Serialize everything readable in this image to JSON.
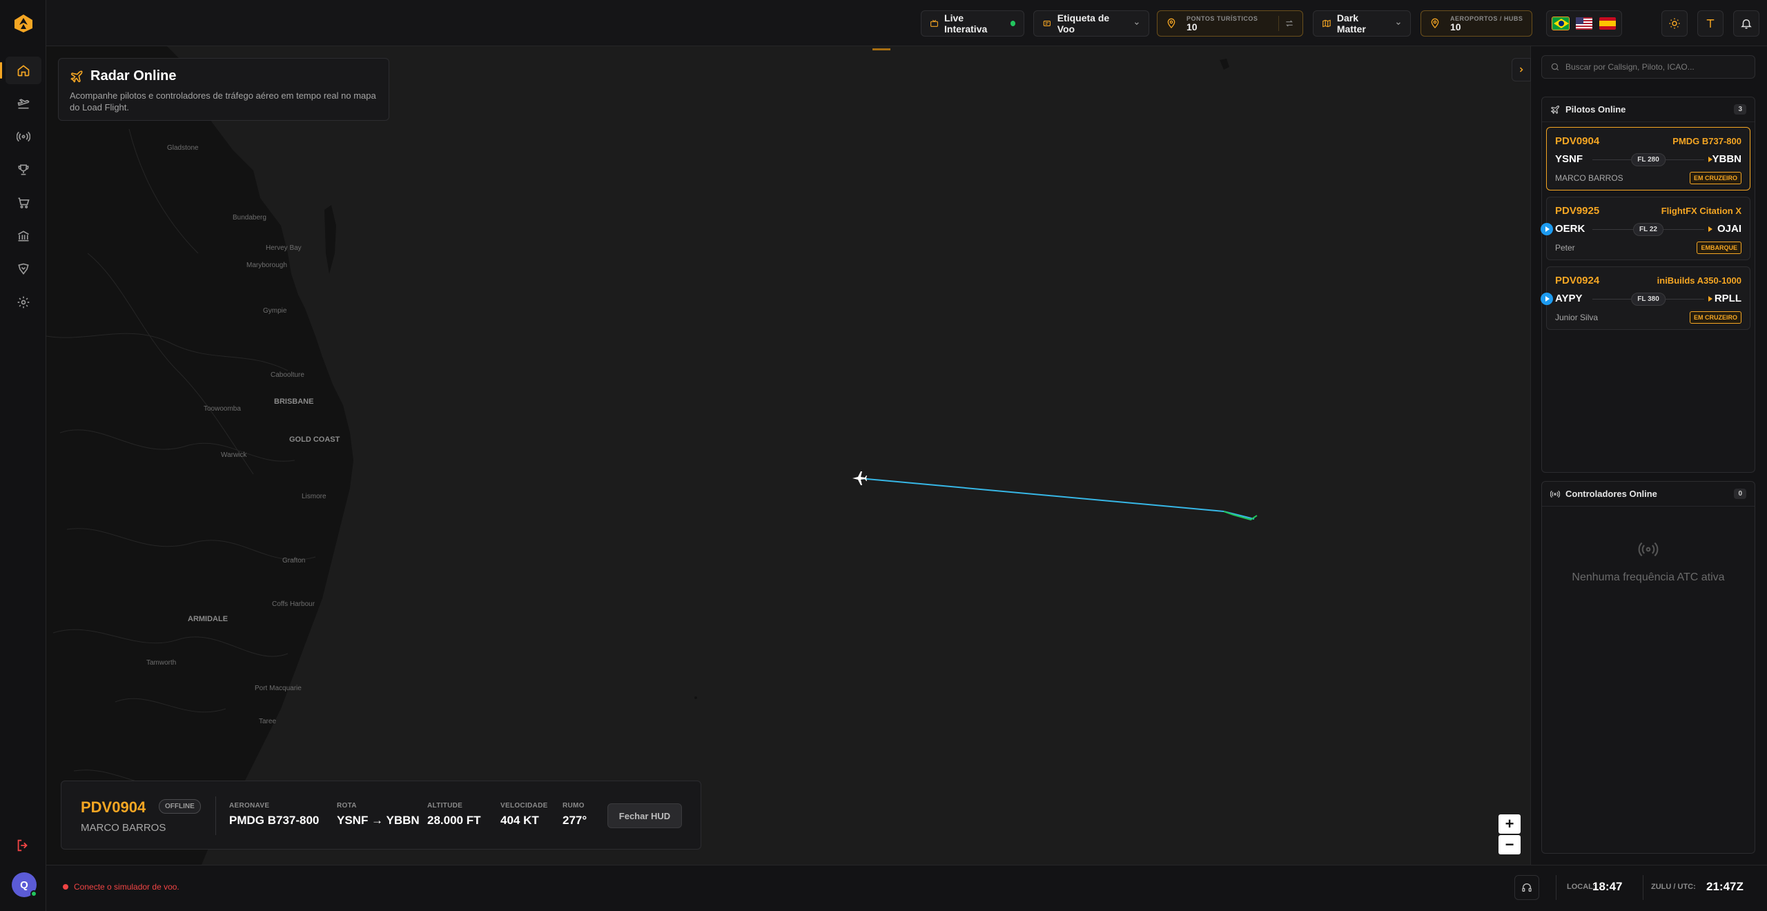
{
  "topbar": {
    "live_label": "Live Interativa",
    "flight_tag_label": "Etiqueta de Voo",
    "tourist_label": "PONTOS TURÍSTICOS",
    "tourist_count": "10",
    "map_style_label": "Dark Matter",
    "airports_label": "AEROPORTOS / HUBS",
    "airports_count": "10",
    "languages": [
      "pt-BR",
      "en-US",
      "es-ES"
    ]
  },
  "radar_card": {
    "title": "Radar Online",
    "subtitle": "Acompanhe pilotos e controladores de tráfego aéreo em tempo real no mapa do Load Flight."
  },
  "map": {
    "cities": [
      {
        "name": "Gladstone",
        "big": false
      },
      {
        "name": "Bundaberg",
        "big": false
      },
      {
        "name": "Hervey Bay",
        "big": false
      },
      {
        "name": "Maryborough",
        "big": false
      },
      {
        "name": "Gympie",
        "big": false
      },
      {
        "name": "Caboolture",
        "big": false
      },
      {
        "name": "Toowoomba",
        "big": false
      },
      {
        "name": "BRISBANE",
        "big": true
      },
      {
        "name": "GOLD COAST",
        "big": true
      },
      {
        "name": "Warwick",
        "big": false
      },
      {
        "name": "Lismore",
        "big": false
      },
      {
        "name": "Grafton",
        "big": false
      },
      {
        "name": "Coffs Harbour",
        "big": false
      },
      {
        "name": "ARMIDALE",
        "big": true
      },
      {
        "name": "Tamworth",
        "big": false
      },
      {
        "name": "Port Macquarie",
        "big": false
      },
      {
        "name": "Taree",
        "big": false
      }
    ],
    "track_color": "#37b7e6",
    "track_end_color": "#22c55e"
  },
  "hud": {
    "callsign": "PDV0904",
    "status": "OFFLINE",
    "pilot": "MARCO BARROS",
    "fields": [
      {
        "label": "AERONAVE",
        "value": "PMDG B737-800"
      },
      {
        "label": "ROTA",
        "value": "YSNF → YBBN"
      },
      {
        "label": "ALTITUDE",
        "value": "28.000 FT"
      },
      {
        "label": "VELOCIDADE",
        "value": "404 KT"
      },
      {
        "label": "RUMO",
        "value": "277°"
      }
    ],
    "close_label": "Fechar HUD"
  },
  "zoom": {
    "in": "+",
    "out": "−"
  },
  "right_panel": {
    "search_placeholder": "Buscar por Callsign, Piloto, ICAO...",
    "pilots_title": "Pilotos Online",
    "pilots_count": "3",
    "pilots": [
      {
        "callsign": "PDV0904",
        "aircraft": "PMDG B737-800",
        "dep": "YSNF",
        "arr": "YBBN",
        "fl": "FL 280",
        "name": "MARCO BARROS",
        "status": "EM CRUZEIRO",
        "selected": true,
        "play": false
      },
      {
        "callsign": "PDV9925",
        "aircraft": "FlightFX Citation X",
        "dep": "OERK",
        "arr": "OJAI",
        "fl": "FL 22",
        "name": "Peter",
        "status": "EMBARQUE",
        "selected": false,
        "play": true
      },
      {
        "callsign": "PDV0924",
        "aircraft": "iniBuilds A350-1000",
        "dep": "AYPY",
        "arr": "RPLL",
        "fl": "FL 380",
        "name": "Junior Silva",
        "status": "EM CRUZEIRO",
        "selected": false,
        "play": true
      }
    ],
    "atc_title": "Controladores Online",
    "atc_count": "0",
    "atc_empty": "Nenhuma frequência ATC ativa"
  },
  "bottombar": {
    "sim_status": "Conecte o simulador de voo.",
    "local_label": "LOCAL:",
    "local_time": "18:47",
    "zulu_label": "ZULU / UTC:",
    "zulu_time": "21:47Z"
  },
  "user": {
    "initial": "Q"
  },
  "colors": {
    "accent": "#f5a623",
    "online": "#22c55e",
    "error": "#ef4444",
    "play": "#1d9bf0"
  }
}
